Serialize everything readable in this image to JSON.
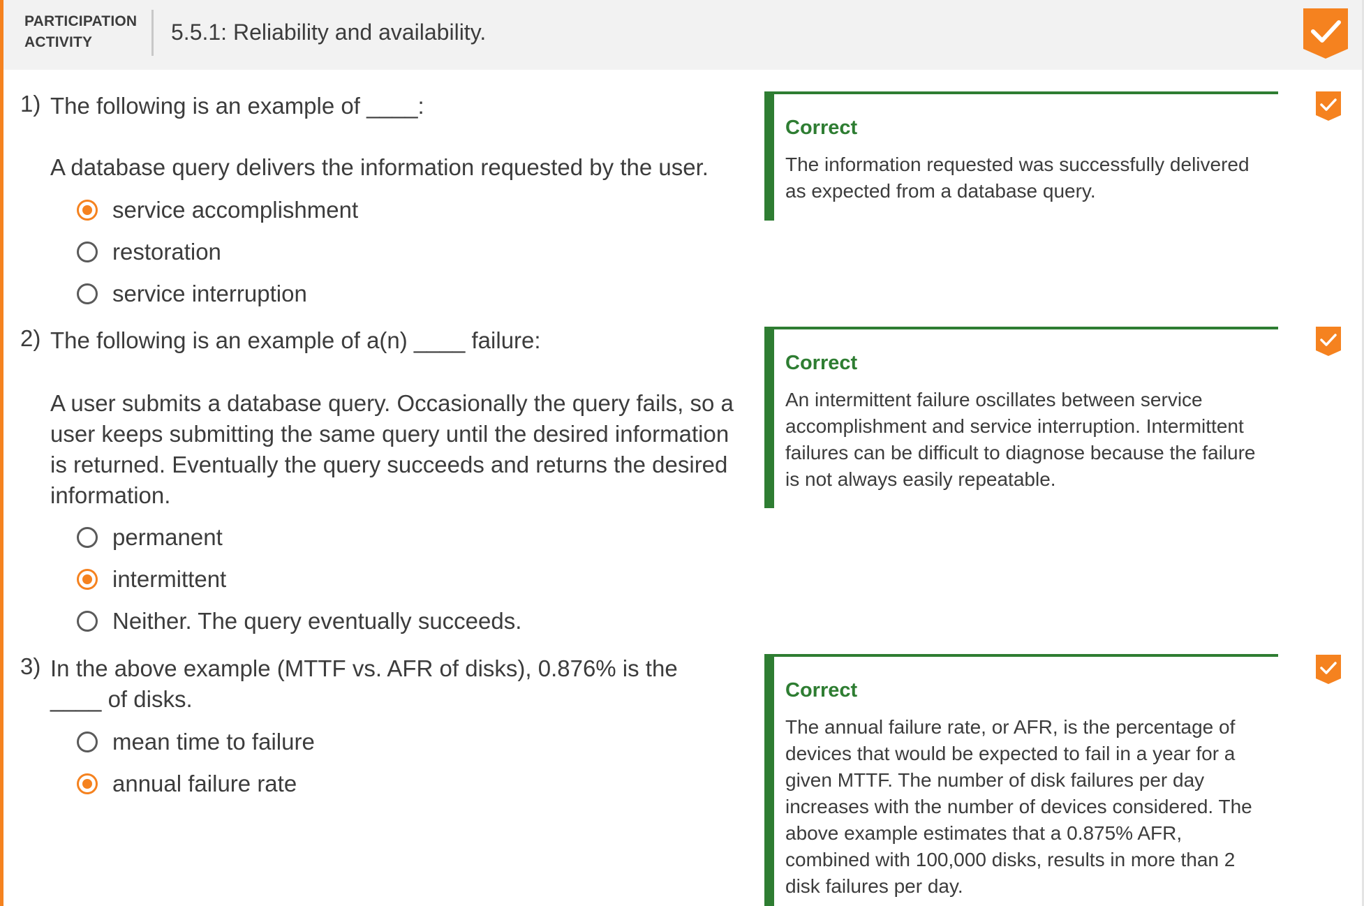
{
  "header": {
    "label_line1": "PARTICIPATION",
    "label_line2": "ACTIVITY",
    "title": "5.5.1: Reliability and availability.",
    "badge_icon": "checkmark-badge-icon",
    "accent_color": "#f5821f"
  },
  "questions": [
    {
      "number": "1)",
      "prompt": "The following is an example of ____:",
      "scenario": "A database query delivers the information requested by the user.",
      "options": [
        {
          "label": "service accomplishment",
          "selected": true
        },
        {
          "label": "restoration",
          "selected": false
        },
        {
          "label": "service interruption",
          "selected": false
        }
      ],
      "feedback": {
        "title": "Correct",
        "text": "The information requested was successfully delivered as expected from a database query."
      }
    },
    {
      "number": "2)",
      "prompt": "The following is an example of a(n) ____ failure:",
      "scenario": "A user submits a database query. Occasionally the query fails, so a user keeps submitting the same query until the desired information is returned. Eventually the query succeeds and returns the desired information.",
      "options": [
        {
          "label": "permanent",
          "selected": false
        },
        {
          "label": "intermittent",
          "selected": true
        },
        {
          "label": "Neither. The query eventually succeeds.",
          "selected": false
        }
      ],
      "feedback": {
        "title": "Correct",
        "text": "An intermittent failure oscillates between service accomplishment and service interruption. Intermittent failures can be difficult to diagnose because the failure is not always easily repeatable."
      }
    },
    {
      "number": "3)",
      "prompt": "In the above example (MTTF vs. AFR of disks), 0.876% is the ____ of disks.",
      "options": [
        {
          "label": "mean time to failure",
          "selected": false
        },
        {
          "label": "annual failure rate",
          "selected": true
        }
      ],
      "feedback": {
        "title": "Correct",
        "text": "The annual failure rate, or AFR, is the percentage of devices that would be expected to fail in a year for a given MTTF. The number of disk failures per day increases with the number of devices considered. The above example estimates that a 0.875% AFR, combined with 100,000 disks, results in more than 2 disk failures per day."
      }
    }
  ],
  "colors": {
    "correct_green": "#2e7d32",
    "orange": "#f5821f"
  }
}
